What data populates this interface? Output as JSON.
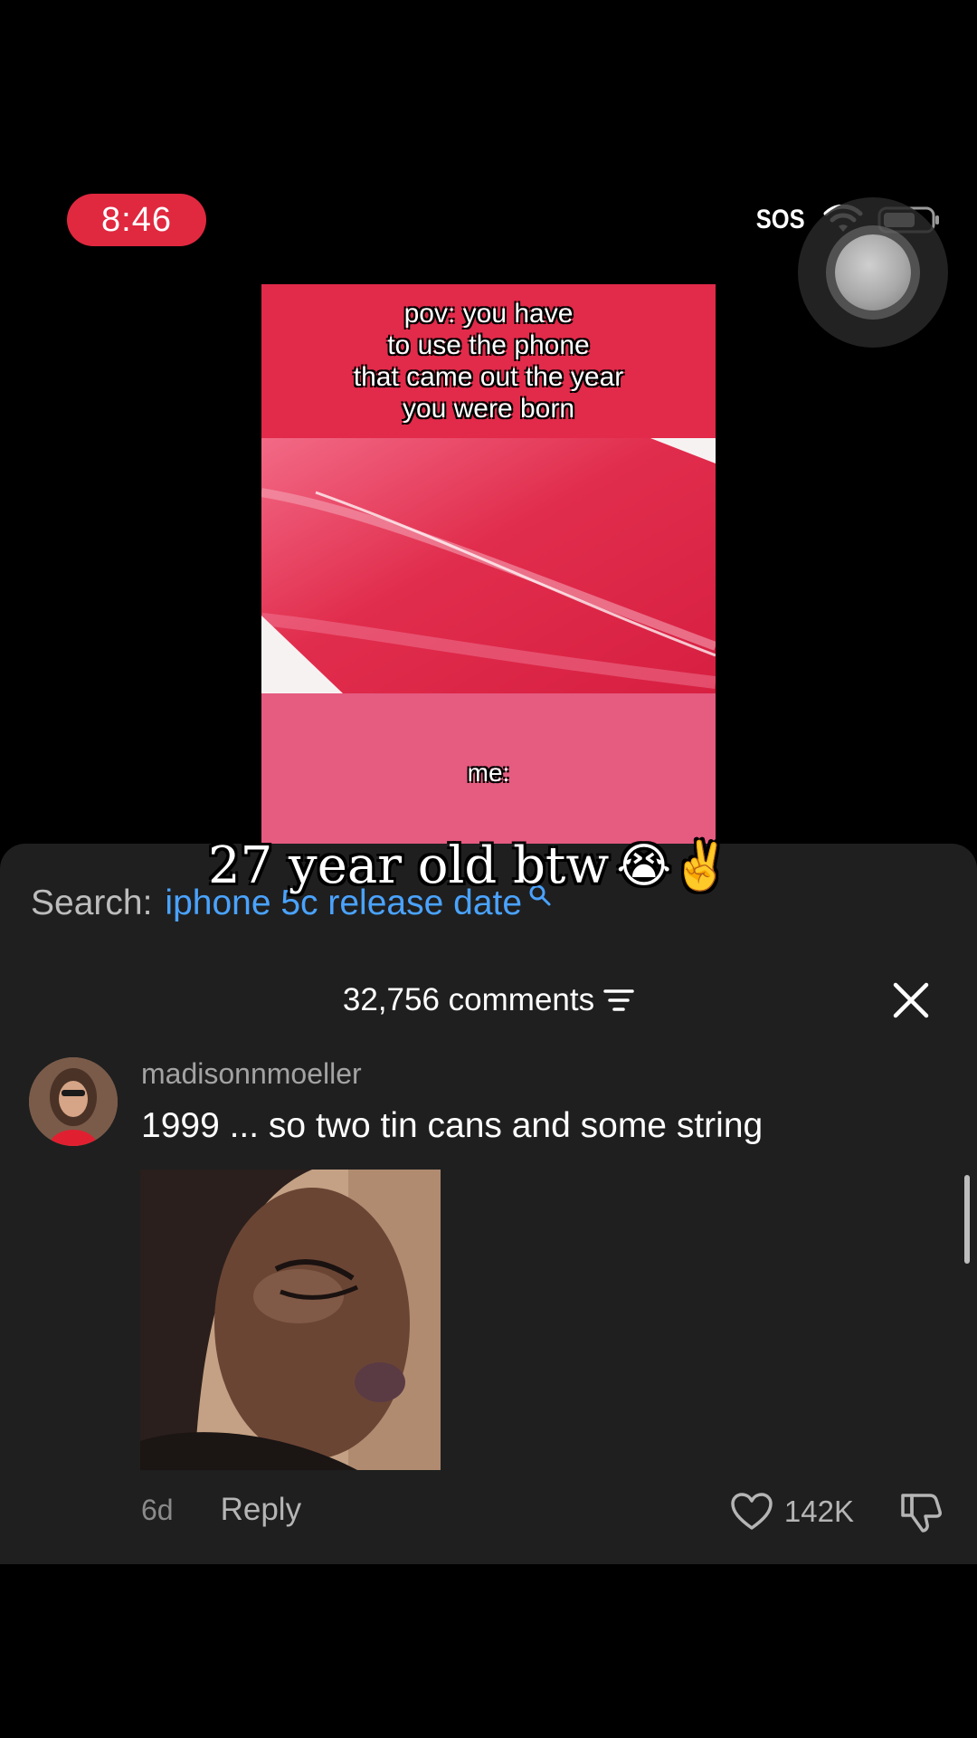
{
  "status_bar": {
    "time": "8:46",
    "sos": "SOS"
  },
  "video": {
    "caption": "pov: you have\nto use the phone\nthat came out the year\nyou were born",
    "bottom_label": "me:",
    "overlay_text": "27 year old btw",
    "overlay_emojis": "😭✌️"
  },
  "search": {
    "prefix": "Search:",
    "term": "iphone 5c release date"
  },
  "comments": {
    "count_label": "32,756 comments"
  },
  "comment": {
    "username": "madisonnmoeller",
    "text": "1999 ... so two tin cans and some string",
    "age": "6d",
    "reply_label": "Reply",
    "likes": "142K"
  },
  "colors": {
    "time_pill": "#e0283f",
    "search_link": "#4aa3ff",
    "sheet_bg": "#1f1f1f"
  }
}
